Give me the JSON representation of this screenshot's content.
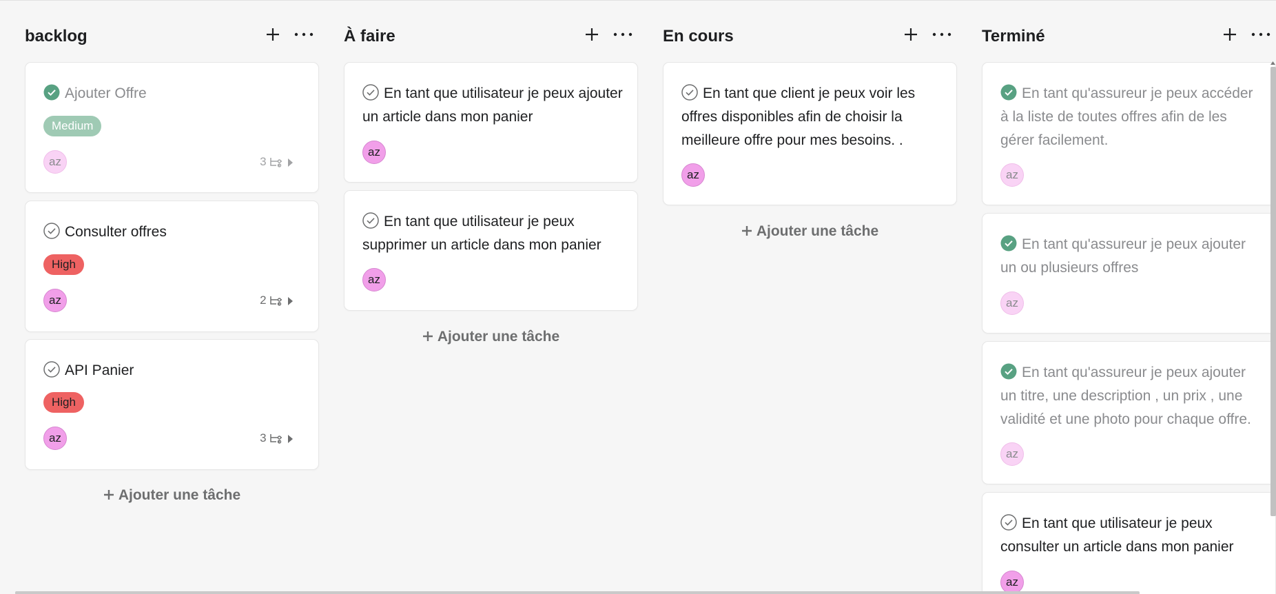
{
  "columns": [
    {
      "title": "backlog",
      "add_label": "Ajouter une tâche",
      "cards": [
        {
          "title": "Ajouter Offre",
          "completed": true,
          "tag": "Medium",
          "assignee": "az",
          "subtasks": "3"
        },
        {
          "title": "Consulter offres",
          "completed": false,
          "tag": "High",
          "assignee": "az",
          "subtasks": "2"
        },
        {
          "title": "API Panier",
          "completed": false,
          "tag": "High",
          "assignee": "az",
          "subtasks": "3"
        }
      ]
    },
    {
      "title": "À faire",
      "add_label": "Ajouter une tâche",
      "cards": [
        {
          "title": "En tant que utilisateur je peux ajouter un article dans mon panier",
          "completed": false,
          "assignee": "az"
        },
        {
          "title": "En tant que utilisateur je peux supprimer un article dans mon panier",
          "completed": false,
          "assignee": "az"
        }
      ]
    },
    {
      "title": "En cours",
      "add_label": "Ajouter une tâche",
      "cards": [
        {
          "title": "En tant que client je peux voir les offres disponibles afin de choisir la meilleure offre pour mes besoins. .",
          "completed": false,
          "assignee": "az"
        }
      ]
    },
    {
      "title": "Terminé",
      "cards": [
        {
          "title": "En tant qu'assureur je peux accéder à la liste de toutes offres afin de les gérer facilement.",
          "completed": true,
          "assignee": "az"
        },
        {
          "title": "En tant qu'assureur je peux ajouter un ou plusieurs offres",
          "completed": true,
          "assignee": "az"
        },
        {
          "title": "En tant qu'assureur je peux ajouter un titre, une description , un prix , une validité et une photo pour chaque offre.",
          "completed": true,
          "assignee": "az"
        },
        {
          "title": "En tant que utilisateur je peux consulter un article dans mon panier",
          "completed": false,
          "assignee": "az"
        }
      ]
    }
  ],
  "colors": {
    "background": "#f6f6f6",
    "card": "#ffffff",
    "completed_check": "#58a182",
    "medium_tag": "#9fcab4",
    "high_tag": "#ee6262",
    "avatar": "#f19fe9"
  },
  "icons": {
    "column_add": "plus-icon",
    "column_more": "more-horizontal-icon",
    "check": "check-circle-icon",
    "subtasks": "subtask-icon",
    "expand": "caret-right-icon"
  }
}
